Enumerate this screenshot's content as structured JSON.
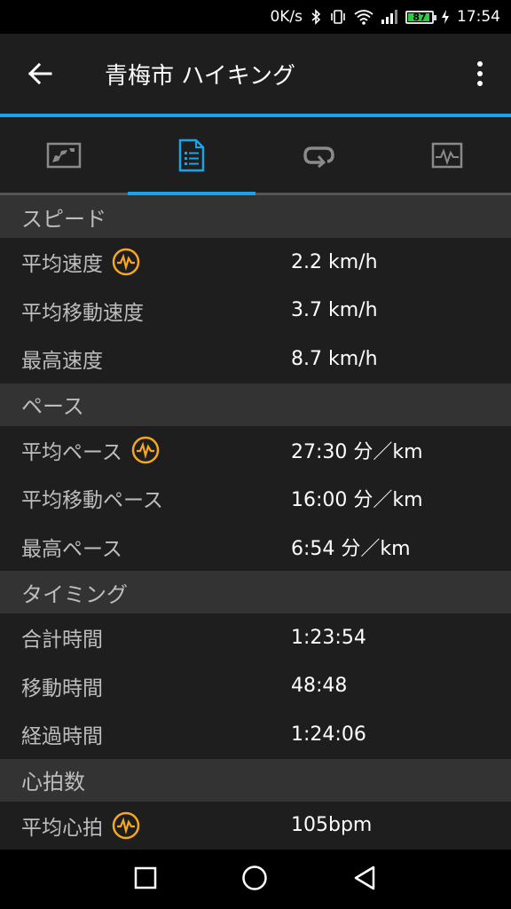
{
  "status_bar": {
    "speed": "0K/s",
    "battery": "87",
    "time": "17:54"
  },
  "app_bar": {
    "title": "青梅市 ハイキング"
  },
  "colors": {
    "accent": "#1aa3e8",
    "avg_icon": "#f5a623",
    "section_bg": "#333333",
    "row_bg": "#1e1e1e"
  },
  "tabs": [
    {
      "icon": "map-icon",
      "active": false
    },
    {
      "icon": "document-list-icon",
      "active": true
    },
    {
      "icon": "laps-icon",
      "active": false
    },
    {
      "icon": "chart-icon",
      "active": false
    }
  ],
  "sections": {
    "speed": {
      "title": "スピード",
      "rows": [
        {
          "label": "平均速度",
          "value": "2.2 km/h"
        },
        {
          "label": "平均移動速度",
          "value": "3.7 km/h"
        },
        {
          "label": "最高速度",
          "value": "8.7 km/h"
        }
      ]
    },
    "pace": {
      "title": "ペース",
      "rows": [
        {
          "label": "平均ペース",
          "value": "27:30 分／km"
        },
        {
          "label": "平均移動ペース",
          "value": "16:00 分／km"
        },
        {
          "label": "最高ペース",
          "value": "6:54 分／km"
        }
      ]
    },
    "timing": {
      "title": "タイミング",
      "rows": [
        {
          "label": "合計時間",
          "value": "1:23:54"
        },
        {
          "label": "移動時間",
          "value": "48:48"
        },
        {
          "label": "経過時間",
          "value": "1:24:06"
        }
      ]
    },
    "heart_rate": {
      "title": "心拍数",
      "rows": [
        {
          "label": "平均心拍",
          "value": "105bpm"
        }
      ]
    }
  }
}
